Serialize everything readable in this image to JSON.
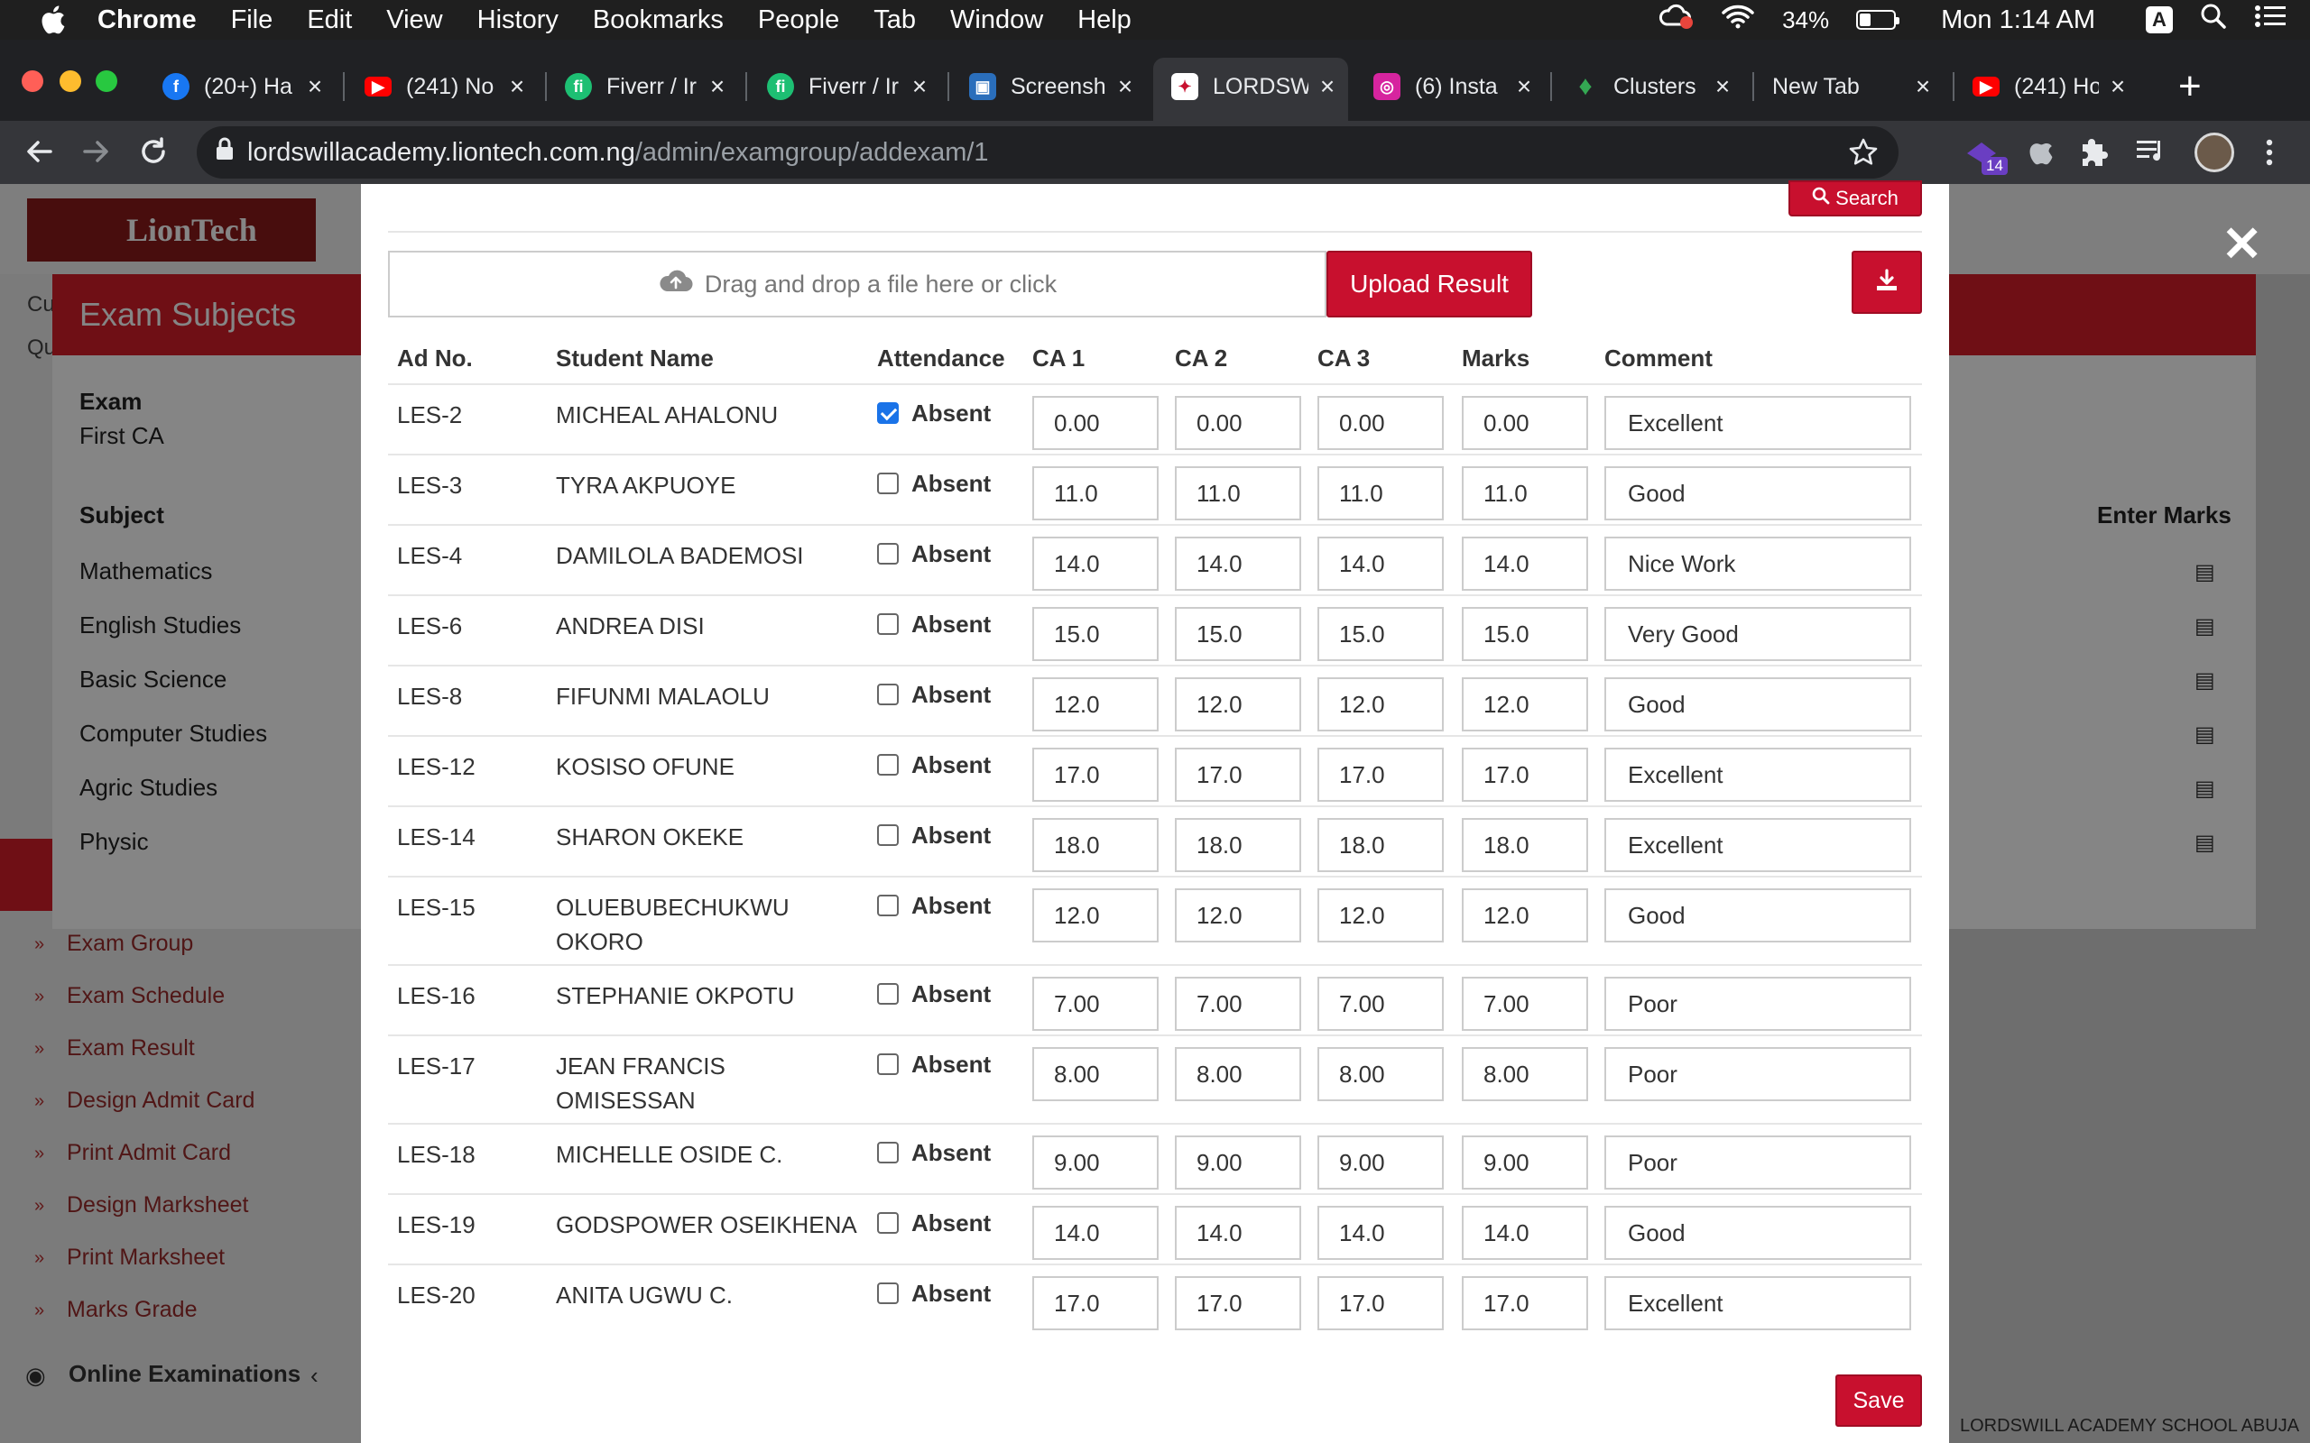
{
  "menubar": {
    "app": "Chrome",
    "items": [
      "File",
      "Edit",
      "View",
      "History",
      "Bookmarks",
      "People",
      "Tab",
      "Window",
      "Help"
    ],
    "battery": "34%",
    "battery_level": 0.34,
    "clock": "Mon 1:14 AM",
    "user_initial": "A"
  },
  "tabs": [
    {
      "title": "(20+) Ha",
      "icon": "facebook-icon",
      "color": "#1877f2"
    },
    {
      "title": "(241) No",
      "icon": "youtube-icon",
      "color": "#ff0000"
    },
    {
      "title": "Fiverr / Ir",
      "icon": "fiverr-icon",
      "color": "#1dbf73"
    },
    {
      "title": "Fiverr / Ir",
      "icon": "fiverr-icon",
      "color": "#1dbf73"
    },
    {
      "title": "Screensh",
      "icon": "screenshot-icon",
      "color": "#2a6ebb"
    },
    {
      "title": "LORDSW",
      "icon": "school-icon",
      "color": "#ffffff"
    },
    {
      "title": "(6) Insta",
      "icon": "instagram-icon",
      "color": "#d6249f"
    },
    {
      "title": "Clusters",
      "icon": "leaf-icon",
      "color": "#34a853"
    },
    {
      "title": "New Tab",
      "icon": "",
      "color": ""
    },
    {
      "title": "(241) Ho",
      "icon": "youtube-icon",
      "color": "#ff0000"
    }
  ],
  "address": {
    "host": "lordswillacademy.liontech.com.ng",
    "path": "/admin/examgroup/addexam/1"
  },
  "extension_badge": "14",
  "background": {
    "logo_text": "LionTech",
    "panel_title": "Exam Subjects",
    "exam_label": "Exam",
    "exam_value": "First CA",
    "subject_label": "Subject",
    "enter_marks_label": "Enter Marks",
    "subjects": [
      "Mathematics",
      "English Studies",
      "Basic Science",
      "Computer Studies",
      "Agric Studies",
      "Physic"
    ],
    "side_menu": [
      "Exam Group",
      "Exam Schedule",
      "Exam Result",
      "Design Admit Card",
      "Print Admit Card",
      "Design Marksheet",
      "Print Marksheet",
      "Marks Grade"
    ],
    "online_exams": "Online Examinations",
    "footer_text": "LORDSWILL ACADEMY SCHOOL ABUJA",
    "left_letters": [
      "Cu",
      "Qu"
    ]
  },
  "modal": {
    "search_label": "Search",
    "dropzone_text": "Drag and drop a file here or click",
    "upload_label": "Upload Result",
    "save_label": "Save",
    "columns": [
      "Ad No.",
      "Student Name",
      "Attendance",
      "CA 1",
      "CA 2",
      "CA 3",
      "Marks",
      "Comment"
    ],
    "absent_label": "Absent",
    "rows": [
      {
        "adno": "LES-2",
        "name": "MICHEAL AHALONU",
        "absent": true,
        "ca1": "0.00",
        "ca2": "0.00",
        "ca3": "0.00",
        "marks": "0.00",
        "comment": "Excellent"
      },
      {
        "adno": "LES-3",
        "name": "TYRA AKPUOYE",
        "absent": false,
        "ca1": "11.0",
        "ca2": "11.0",
        "ca3": "11.0",
        "marks": "11.0",
        "comment": "Good"
      },
      {
        "adno": "LES-4",
        "name": "DAMILOLA BADEMOSI",
        "absent": false,
        "ca1": "14.0",
        "ca2": "14.0",
        "ca3": "14.0",
        "marks": "14.0",
        "comment": "Nice Work"
      },
      {
        "adno": "LES-6",
        "name": "ANDREA DISI",
        "absent": false,
        "ca1": "15.0",
        "ca2": "15.0",
        "ca3": "15.0",
        "marks": "15.0",
        "comment": "Very Good"
      },
      {
        "adno": "LES-8",
        "name": "FIFUNMI MALAOLU",
        "absent": false,
        "ca1": "12.0",
        "ca2": "12.0",
        "ca3": "12.0",
        "marks": "12.0",
        "comment": "Good"
      },
      {
        "adno": "LES-12",
        "name": "KOSISO OFUNE",
        "absent": false,
        "ca1": "17.0",
        "ca2": "17.0",
        "ca3": "17.0",
        "marks": "17.0",
        "comment": "Excellent"
      },
      {
        "adno": "LES-14",
        "name": "SHARON OKEKE",
        "absent": false,
        "ca1": "18.0",
        "ca2": "18.0",
        "ca3": "18.0",
        "marks": "18.0",
        "comment": "Excellent"
      },
      {
        "adno": "LES-15",
        "name": "OLUEBUBECHUKWU OKORO",
        "absent": false,
        "ca1": "12.0",
        "ca2": "12.0",
        "ca3": "12.0",
        "marks": "12.0",
        "comment": "Good"
      },
      {
        "adno": "LES-16",
        "name": "STEPHANIE OKPOTU",
        "absent": false,
        "ca1": "7.00",
        "ca2": "7.00",
        "ca3": "7.00",
        "marks": "7.00",
        "comment": "Poor"
      },
      {
        "adno": "LES-17",
        "name": "JEAN FRANCIS OMISESSAN",
        "absent": false,
        "ca1": "8.00",
        "ca2": "8.00",
        "ca3": "8.00",
        "marks": "8.00",
        "comment": "Poor"
      },
      {
        "adno": "LES-18",
        "name": "MICHELLE OSIDE C.",
        "absent": false,
        "ca1": "9.00",
        "ca2": "9.00",
        "ca3": "9.00",
        "marks": "9.00",
        "comment": "Poor"
      },
      {
        "adno": "LES-19",
        "name": "GODSPOWER OSEIKHENA",
        "absent": false,
        "ca1": "14.0",
        "ca2": "14.0",
        "ca3": "14.0",
        "marks": "14.0",
        "comment": "Good"
      },
      {
        "adno": "LES-20",
        "name": "ANITA UGWU C.",
        "absent": false,
        "ca1": "17.0",
        "ca2": "17.0",
        "ca3": "17.0",
        "marks": "17.0",
        "comment": "Excellent"
      }
    ]
  },
  "colors": {
    "accent_red": "#c8102e",
    "checkbox_blue": "#1a73e8"
  }
}
